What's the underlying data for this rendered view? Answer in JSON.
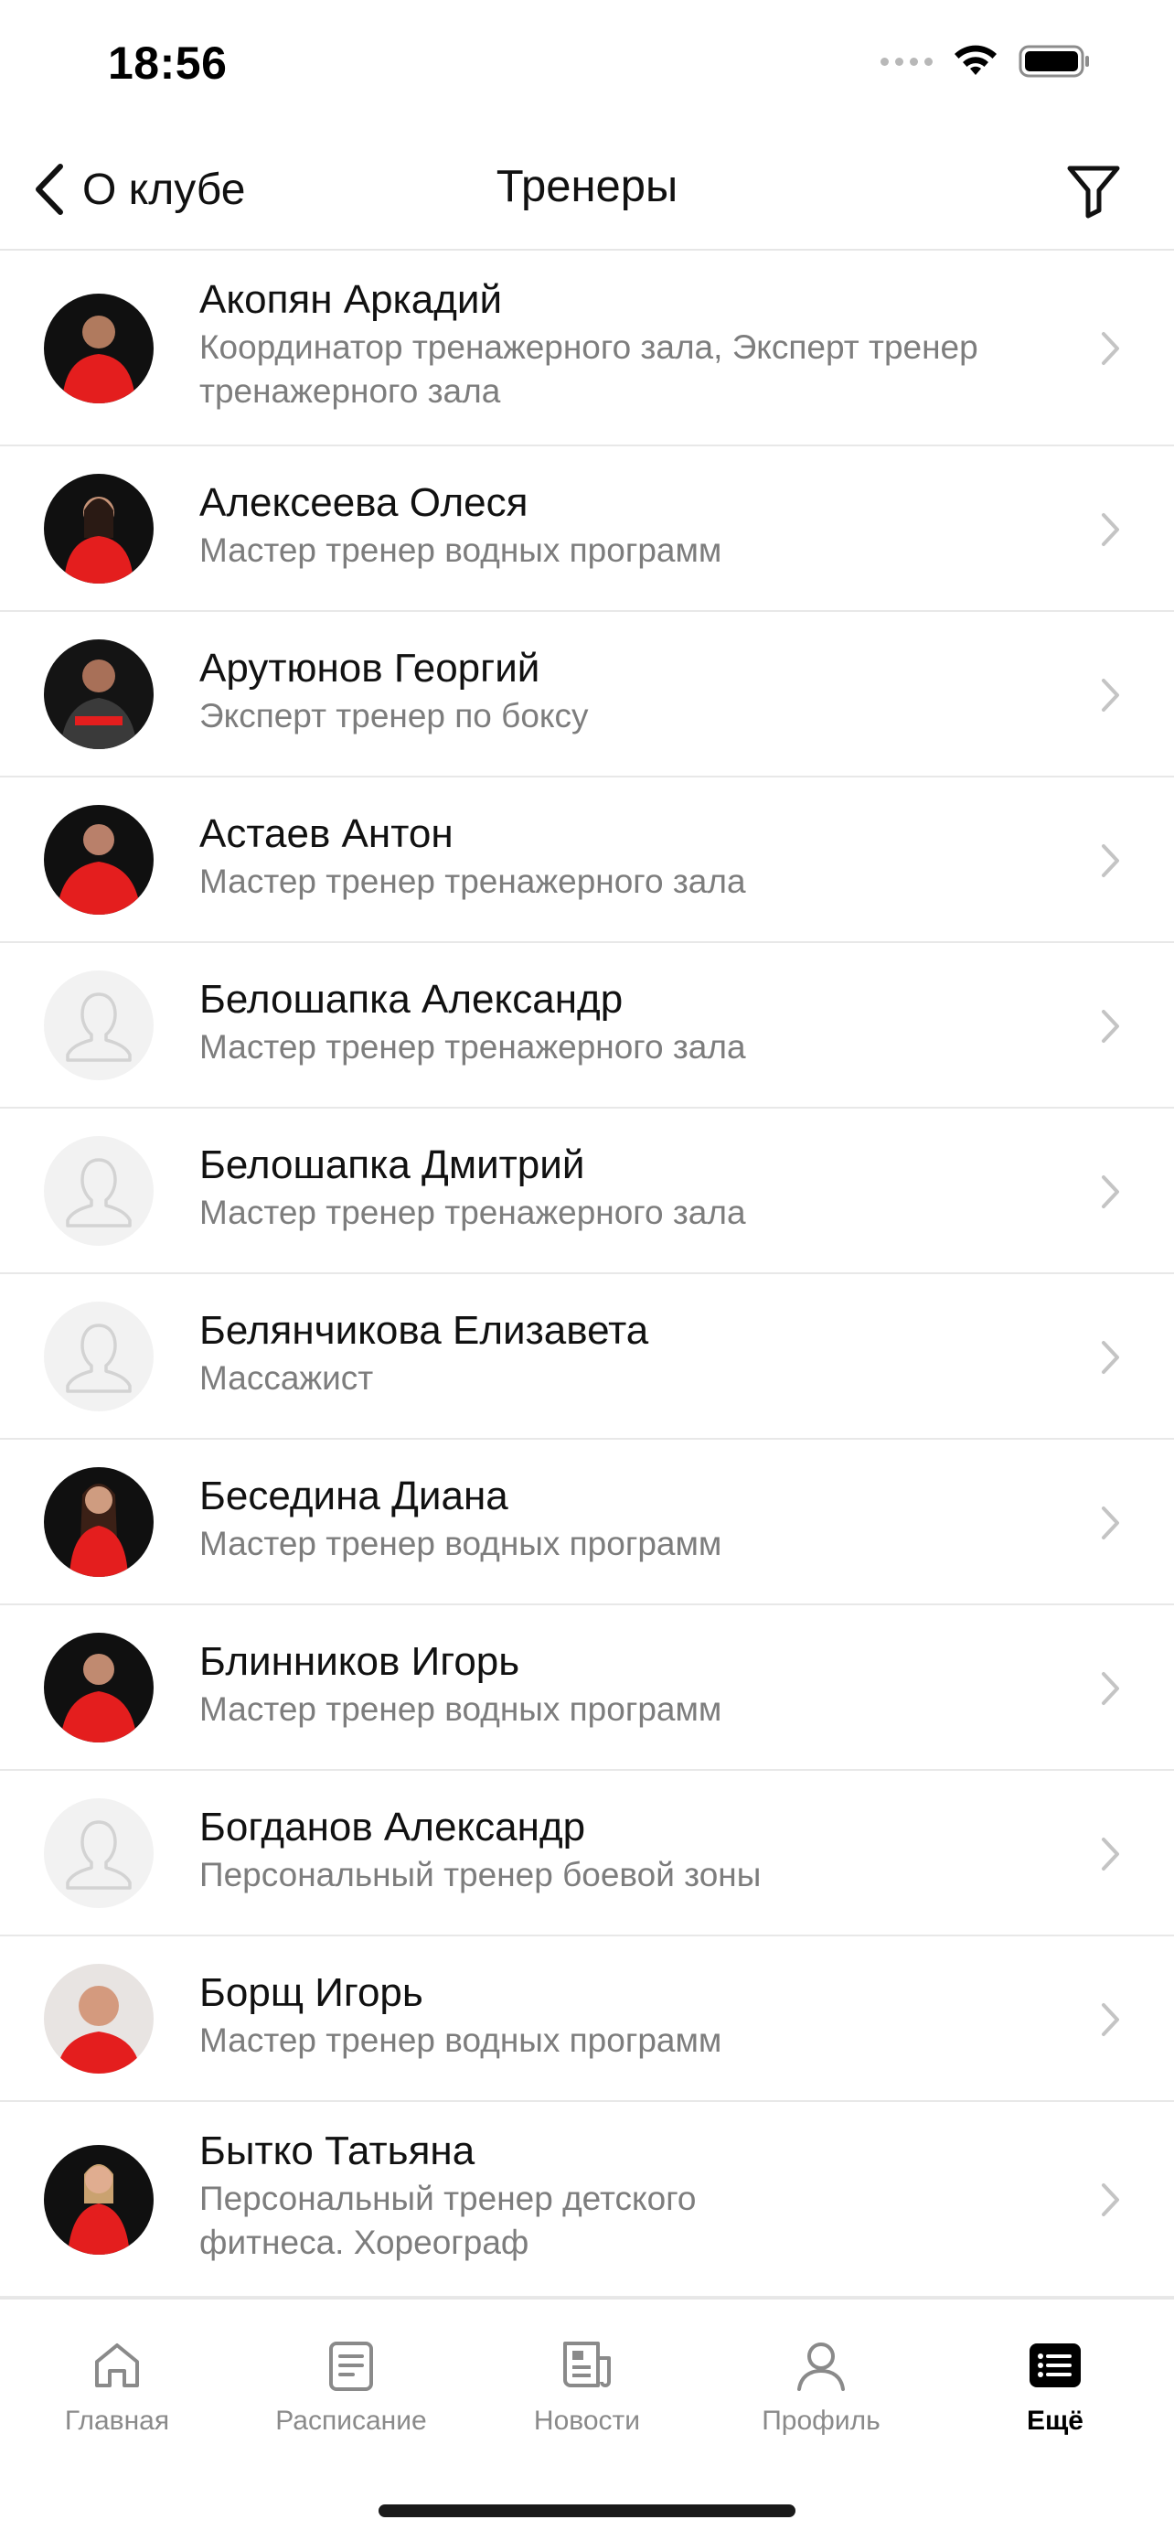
{
  "status_bar": {
    "time": "18:56"
  },
  "nav": {
    "back_label": "О клубе",
    "title": "Тренеры"
  },
  "colors": {
    "accent_red": "#e41e1e",
    "text_gray": "#7d7d7d",
    "separator": "#e8e8e8"
  },
  "trainers": [
    {
      "name": "Акопян Аркадий",
      "role": "Координатор тренажерного зала, Эксперт тренер тренажерного зала",
      "role_line1": "Координатор тренажерного зала, Эксперт тренер",
      "role_line2": "тренажерного зала",
      "avatar": "photo"
    },
    {
      "name": "Алексеева Олеся",
      "role": "Мастер тренер водных программ",
      "avatar": "photo"
    },
    {
      "name": "Арутюнов Георгий",
      "role": "Эксперт тренер по боксу",
      "avatar": "photo"
    },
    {
      "name": "Астаев Антон",
      "role": "Мастер тренер тренажерного зала",
      "avatar": "photo"
    },
    {
      "name": "Белошапка Александр",
      "role": "Мастер тренер тренажерного зала",
      "avatar": "placeholder"
    },
    {
      "name": "Белошапка Дмитрий",
      "role": "Мастер тренер тренажерного зала",
      "avatar": "placeholder"
    },
    {
      "name": "Белянчикова Елизавета",
      "role": "Массажист",
      "avatar": "placeholder"
    },
    {
      "name": "Беседина Диана",
      "role": "Мастер тренер водных программ",
      "avatar": "photo"
    },
    {
      "name": "Блинников Игорь",
      "role": "Мастер тренер водных программ",
      "avatar": "photo"
    },
    {
      "name": "Богданов Александр",
      "role": "Персональный тренер боевой зоны",
      "avatar": "placeholder"
    },
    {
      "name": "Борщ Игорь",
      "role": "Мастер тренер водных программ",
      "avatar": "photo"
    },
    {
      "name": "Бытко Татьяна",
      "role": "Персональный тренер детского фитнеса. Хореограф",
      "role_line1": "Персональный тренер детского",
      "role_line2": "фитнеса. Хореограф",
      "avatar": "photo"
    }
  ],
  "tabs": [
    {
      "label": "Главная",
      "icon": "home-icon"
    },
    {
      "label": "Расписание",
      "icon": "schedule-icon"
    },
    {
      "label": "Новости",
      "icon": "news-icon"
    },
    {
      "label": "Профиль",
      "icon": "profile-icon"
    },
    {
      "label": "Ещё",
      "icon": "more-list-icon",
      "active": true
    }
  ]
}
